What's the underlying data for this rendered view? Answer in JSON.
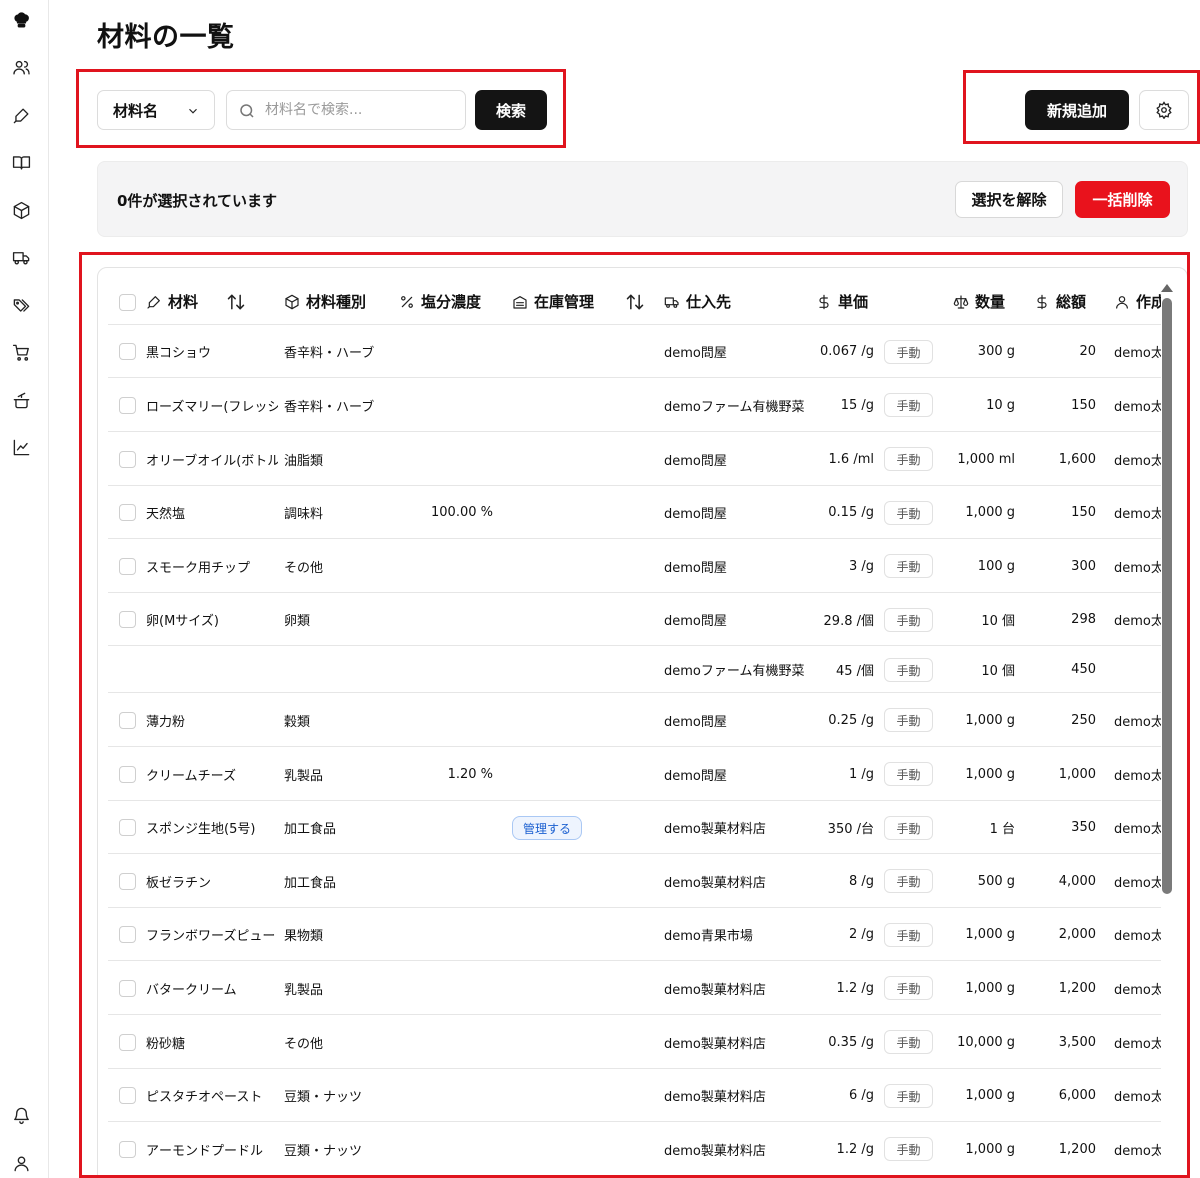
{
  "page": {
    "title": "材料の一覧"
  },
  "sidebar": {
    "icons": [
      "logo-icon",
      "users-icon",
      "pen-icon",
      "book-icon",
      "box-icon",
      "truck-icon",
      "tags-icon",
      "cart-icon",
      "cooking-pot-icon",
      "chart-icon",
      "bell-icon",
      "user-icon"
    ]
  },
  "search": {
    "field_select": "材料名",
    "placeholder": "材料名で検索...",
    "value": "",
    "button_label": "検索"
  },
  "toolbar": {
    "add_label": "新規追加"
  },
  "selection": {
    "text": "0件が選択されています",
    "clear_label": "選択を解除",
    "delete_label": "一括削除"
  },
  "table": {
    "headers": {
      "material": "材料",
      "category": "材料種別",
      "salt": "塩分濃度",
      "stock": "在庫管理",
      "supplier": "仕入先",
      "unit_price": "単価",
      "quantity": "数量",
      "total": "総額",
      "creator": "作成"
    },
    "rows": [
      {
        "name": "黒コショウ",
        "category": "香辛料・ハーブ",
        "salt": "",
        "stock": "",
        "supplier": "demo問屋",
        "unit_price": "0.067 /g",
        "mode": "手動",
        "quantity": "300 g",
        "total": "20",
        "creator": "demo太郎"
      },
      {
        "name": "ローズマリー(フレッシュ)",
        "category": "香辛料・ハーブ",
        "salt": "",
        "stock": "",
        "supplier": "demoファーム有機野菜",
        "unit_price": "15 /g",
        "mode": "手動",
        "quantity": "10 g",
        "total": "150",
        "creator": "demo太郎"
      },
      {
        "name": "オリーブオイル(ボトル)",
        "category": "油脂類",
        "salt": "",
        "stock": "",
        "supplier": "demo問屋",
        "unit_price": "1.6 /ml",
        "mode": "手動",
        "quantity": "1,000 ml",
        "total": "1,600",
        "creator": "demo太郎"
      },
      {
        "name": "天然塩",
        "category": "調味料",
        "salt": "100.00 %",
        "stock": "",
        "supplier": "demo問屋",
        "unit_price": "0.15 /g",
        "mode": "手動",
        "quantity": "1,000 g",
        "total": "150",
        "creator": "demo太郎"
      },
      {
        "name": "スモーク用チップ",
        "category": "その他",
        "salt": "",
        "stock": "",
        "supplier": "demo問屋",
        "unit_price": "3 /g",
        "mode": "手動",
        "quantity": "100 g",
        "total": "300",
        "creator": "demo太郎"
      },
      {
        "name": "卵(Mサイズ)",
        "category": "卵類",
        "salt": "",
        "stock": "",
        "supplier": "demo問屋",
        "unit_price": "29.8 /個",
        "mode": "手動",
        "quantity": "10 個",
        "total": "298",
        "creator": "demo太郎"
      },
      {
        "sub": true,
        "name": "",
        "category": "",
        "salt": "",
        "stock": "",
        "supplier": "demoファーム有機野菜",
        "unit_price": "45 /個",
        "mode": "手動",
        "quantity": "10 個",
        "total": "450",
        "creator": ""
      },
      {
        "name": "薄力粉",
        "category": "穀類",
        "salt": "",
        "stock": "",
        "supplier": "demo問屋",
        "unit_price": "0.25 /g",
        "mode": "手動",
        "quantity": "1,000 g",
        "total": "250",
        "creator": "demo太郎"
      },
      {
        "name": "クリームチーズ",
        "category": "乳製品",
        "salt": "1.20 %",
        "stock": "",
        "supplier": "demo問屋",
        "unit_price": "1 /g",
        "mode": "手動",
        "quantity": "1,000 g",
        "total": "1,000",
        "creator": "demo太郎"
      },
      {
        "name": "スポンジ生地(5号)",
        "category": "加工食品",
        "salt": "",
        "stock": "管理する",
        "supplier": "demo製菓材料店",
        "unit_price": "350 /台",
        "mode": "手動",
        "quantity": "1 台",
        "total": "350",
        "creator": "demo太郎"
      },
      {
        "name": "板ゼラチン",
        "category": "加工食品",
        "salt": "",
        "stock": "",
        "supplier": "demo製菓材料店",
        "unit_price": "8 /g",
        "mode": "手動",
        "quantity": "500 g",
        "total": "4,000",
        "creator": "demo太郎"
      },
      {
        "name": "フランボワーズピューレ",
        "category": "果物類",
        "salt": "",
        "stock": "",
        "supplier": "demo青果市場",
        "unit_price": "2 /g",
        "mode": "手動",
        "quantity": "1,000 g",
        "total": "2,000",
        "creator": "demo太郎"
      },
      {
        "name": "バタークリーム",
        "category": "乳製品",
        "salt": "",
        "stock": "",
        "supplier": "demo製菓材料店",
        "unit_price": "1.2 /g",
        "mode": "手動",
        "quantity": "1,000 g",
        "total": "1,200",
        "creator": "demo太郎"
      },
      {
        "name": "粉砂糖",
        "category": "その他",
        "salt": "",
        "stock": "",
        "supplier": "demo製菓材料店",
        "unit_price": "0.35 /g",
        "mode": "手動",
        "quantity": "10,000 g",
        "total": "3,500",
        "creator": "demo太郎"
      },
      {
        "name": "ピスタチオペースト",
        "category": "豆類・ナッツ",
        "salt": "",
        "stock": "",
        "supplier": "demo製菓材料店",
        "unit_price": "6 /g",
        "mode": "手動",
        "quantity": "1,000 g",
        "total": "6,000",
        "creator": "demo太郎"
      },
      {
        "name": "アーモンドプードル",
        "category": "豆類・ナッツ",
        "salt": "",
        "stock": "",
        "supplier": "demo製菓材料店",
        "unit_price": "1.2 /g",
        "mode": "手動",
        "quantity": "1,000 g",
        "total": "1,200",
        "creator": "demo太郎"
      }
    ]
  },
  "colors": {
    "primary": "#141414",
    "danger": "#e9121c",
    "annotation_red": "#e0141e",
    "badge_blue": "#1a5fd0"
  }
}
